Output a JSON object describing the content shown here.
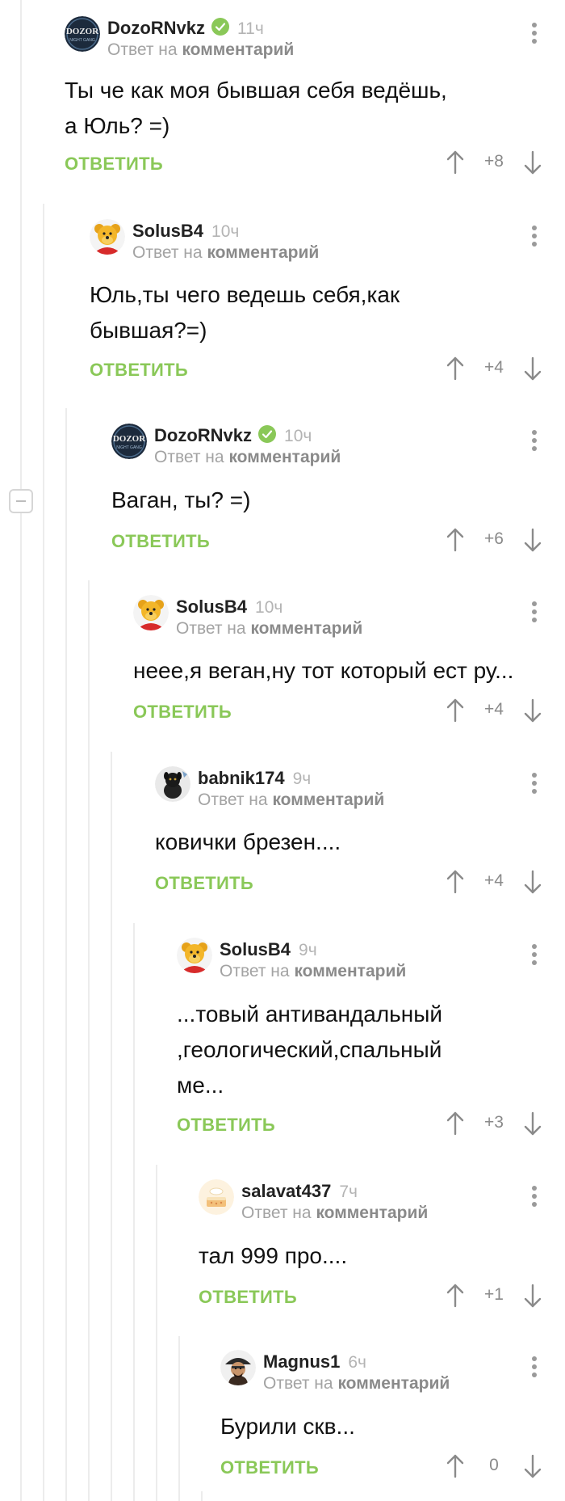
{
  "comments": [
    {
      "author": "DozoRNvkz",
      "time": "11ч",
      "verified": true,
      "reply_prefix": "Ответ на",
      "reply_target": "комментарий",
      "text": "Ты че как моя бывшая себя ведёшь,\nа Юль? =)",
      "reply_label": "ОТВЕТИТЬ",
      "score": "+8",
      "avatar": "dozor-logo"
    },
    {
      "author": "SolusB4",
      "time": "10ч",
      "verified": false,
      "reply_prefix": "Ответ на",
      "reply_target": "комментарий",
      "text": "Юль,ты чего ведешь себя,как\nбывшая?=)",
      "reply_label": "ОТВЕТИТЬ",
      "score": "+4",
      "avatar": "winnie-pooh"
    },
    {
      "author": "DozoRNvkz",
      "time": "10ч",
      "verified": true,
      "reply_prefix": "Ответ на",
      "reply_target": "комментарий",
      "text": "Ваган, ты? =)",
      "reply_label": "ОТВЕТИТЬ",
      "score": "+6",
      "avatar": "dozor-logo"
    },
    {
      "author": "SolusB4",
      "time": "10ч",
      "verified": false,
      "reply_prefix": "Ответ на",
      "reply_target": "комментарий",
      "text": "неее,я веган,ну тот который ест ру...",
      "reply_label": "ОТВЕТИТЬ",
      "score": "+4",
      "avatar": "winnie-pooh"
    },
    {
      "author": "babnik174",
      "time": "9ч",
      "verified": false,
      "reply_prefix": "Ответ на",
      "reply_target": "комментарий",
      "text": "ковички брезен....",
      "reply_label": "ОТВЕТИТЬ",
      "score": "+4",
      "avatar": "black-dog"
    },
    {
      "author": "SolusB4",
      "time": "9ч",
      "verified": false,
      "reply_prefix": "Ответ на",
      "reply_target": "комментарий",
      "text": "...товый антивандальный\n,геологический,спальный\nме...",
      "reply_label": "ОТВЕТИТЬ",
      "score": "+3",
      "avatar": "winnie-pooh"
    },
    {
      "author": "salavat437",
      "time": "7ч",
      "verified": false,
      "reply_prefix": "Ответ на",
      "reply_target": "комментарий",
      "text": "тал 999 про....",
      "reply_label": "ОТВЕТИТЬ",
      "score": "+1",
      "avatar": "cake"
    },
    {
      "author": "Magnus1",
      "time": "6ч",
      "verified": false,
      "reply_prefix": "Ответ на",
      "reply_target": "комментарий",
      "text": "Бурили скв...",
      "reply_label": "ОТВЕТИТЬ",
      "score": "0",
      "avatar": "pirate"
    }
  ],
  "colors": {
    "accent": "#8ac858",
    "muted": "#a3a3a3",
    "thread_line": "#ececec"
  },
  "icons": {
    "upvote": "arrow-up-icon",
    "downvote": "arrow-down-icon",
    "menu": "more-vertical-icon",
    "collapse": "collapse-minus-icon",
    "verified": "verified-check-icon"
  }
}
